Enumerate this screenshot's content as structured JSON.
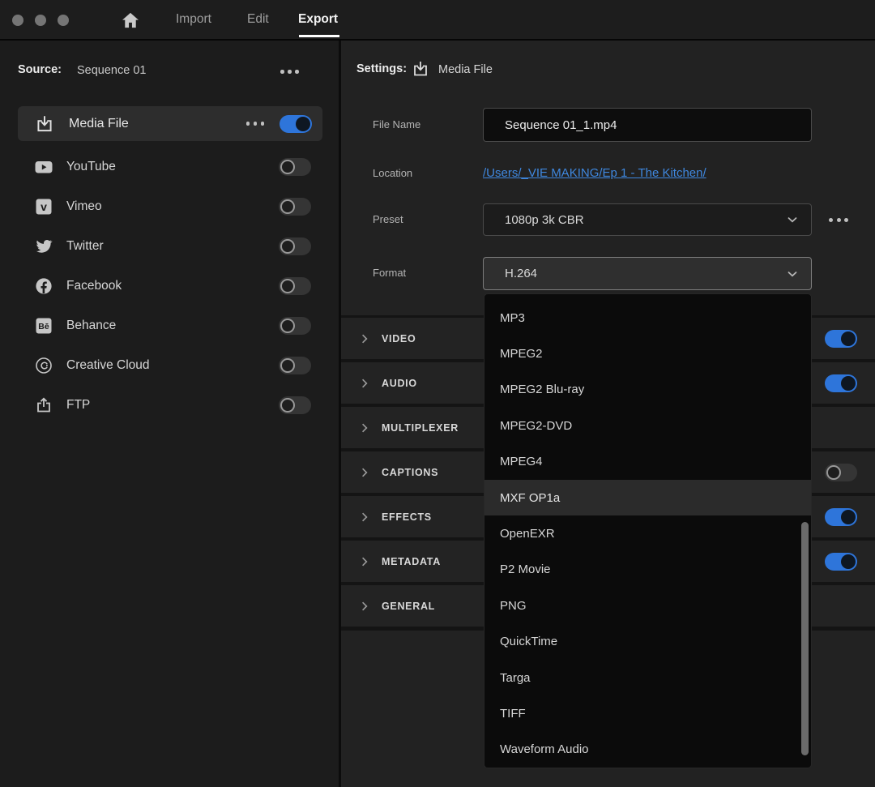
{
  "colors": {
    "accent_blue": "#2e75da",
    "link_blue": "#3f88e0"
  },
  "titlebar": {
    "tabs": [
      {
        "label": "Import"
      },
      {
        "label": "Edit"
      },
      {
        "label": "Export"
      }
    ],
    "active_tab": "Export"
  },
  "sidebar": {
    "source_label": "Source:",
    "source_value": "Sequence 01",
    "items": [
      {
        "label": "Media File",
        "icon": "download-icon",
        "selected": true,
        "toggle": "on"
      },
      {
        "label": "YouTube",
        "icon": "youtube-icon",
        "selected": false,
        "toggle": "off"
      },
      {
        "label": "Vimeo",
        "icon": "vimeo-icon",
        "selected": false,
        "toggle": "off"
      },
      {
        "label": "Twitter",
        "icon": "twitter-icon",
        "selected": false,
        "toggle": "off"
      },
      {
        "label": "Facebook",
        "icon": "facebook-icon",
        "selected": false,
        "toggle": "off"
      },
      {
        "label": "Behance",
        "icon": "behance-icon",
        "selected": false,
        "toggle": "off"
      },
      {
        "label": "Creative Cloud",
        "icon": "creative-cloud-icon",
        "selected": false,
        "toggle": "off"
      },
      {
        "label": "FTP",
        "icon": "upload-icon",
        "selected": false,
        "toggle": "off"
      }
    ]
  },
  "settings": {
    "header_label": "Settings:",
    "header_icon": "download-icon",
    "header_value": "Media File",
    "file_name_label": "File Name",
    "file_name_value": "Sequence 01_1.mp4",
    "location_label": "Location",
    "location_value": "/Users/_VIE MAKING/Ep 1 - The Kitchen/",
    "preset_label": "Preset",
    "preset_value": "1080p 3k CBR",
    "format_label": "Format",
    "format_value": "H.264"
  },
  "sections": [
    {
      "label": "VIDEO",
      "toggle": "on"
    },
    {
      "label": "AUDIO",
      "toggle": "on"
    },
    {
      "label": "MULTIPLEXER",
      "toggle": null
    },
    {
      "label": "CAPTIONS",
      "toggle": "off"
    },
    {
      "label": "EFFECTS",
      "toggle": "on"
    },
    {
      "label": "METADATA",
      "toggle": "on"
    },
    {
      "label": "GENERAL",
      "toggle": null
    }
  ],
  "format_dropdown": {
    "options": [
      "MP3",
      "MPEG2",
      "MPEG2 Blu-ray",
      "MPEG2-DVD",
      "MPEG4",
      "MXF OP1a",
      "OpenEXR",
      "P2 Movie",
      "PNG",
      "QuickTime",
      "Targa",
      "TIFF",
      "Waveform Audio"
    ],
    "highlighted_option": "MXF OP1a"
  }
}
